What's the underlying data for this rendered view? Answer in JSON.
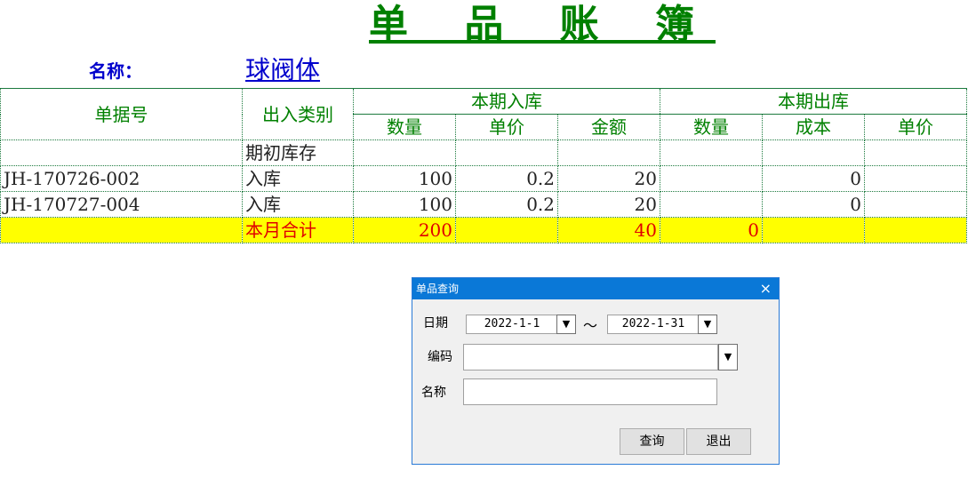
{
  "title": "单 品 账 簿",
  "name_label": "名称：",
  "name_value": "球阀体",
  "ledger": {
    "headers": {
      "doc_no": "单据号",
      "type": "出入类别",
      "in_group": "本期入库",
      "out_group": "本期出库",
      "in_qty": "数量",
      "in_price": "单价",
      "in_amount": "金额",
      "out_qty": "数量",
      "out_cost": "成本",
      "out_price": "单价"
    },
    "rows": [
      {
        "doc_no": "",
        "type": "期初库存",
        "in_qty": "",
        "in_price": "",
        "in_amount": "",
        "out_qty": "",
        "out_cost": "",
        "out_price": ""
      },
      {
        "doc_no": "JH-170726-002",
        "type": "入库",
        "in_qty": "100",
        "in_price": "0.2",
        "in_amount": "20",
        "out_qty": "",
        "out_cost": "0",
        "out_price": ""
      },
      {
        "doc_no": "JH-170727-004",
        "type": "入库",
        "in_qty": "100",
        "in_price": "0.2",
        "in_amount": "20",
        "out_qty": "",
        "out_cost": "0",
        "out_price": ""
      }
    ],
    "total": {
      "doc_no": "",
      "type": "本月合计",
      "in_qty": "200",
      "in_price": "",
      "in_amount": "40",
      "out_qty": "0",
      "out_cost": "",
      "out_price": ""
    }
  },
  "dialog": {
    "title": "单品查询",
    "close": "×",
    "date_label": "日期",
    "date_from": "2022-1-1",
    "tilde": "～",
    "date_to": "2022-1-31",
    "code_label": "编码",
    "code_value": "",
    "name_label": "名称",
    "name_value": "",
    "dropdown_glyph": "▼",
    "query_button": "查询",
    "exit_button": "退出"
  },
  "colors": {
    "header_green": "#008000",
    "name_blue": "#0000cc",
    "total_bg": "#ffff00",
    "total_text": "#e00000",
    "dialog_title_bg": "#0a78d7"
  }
}
